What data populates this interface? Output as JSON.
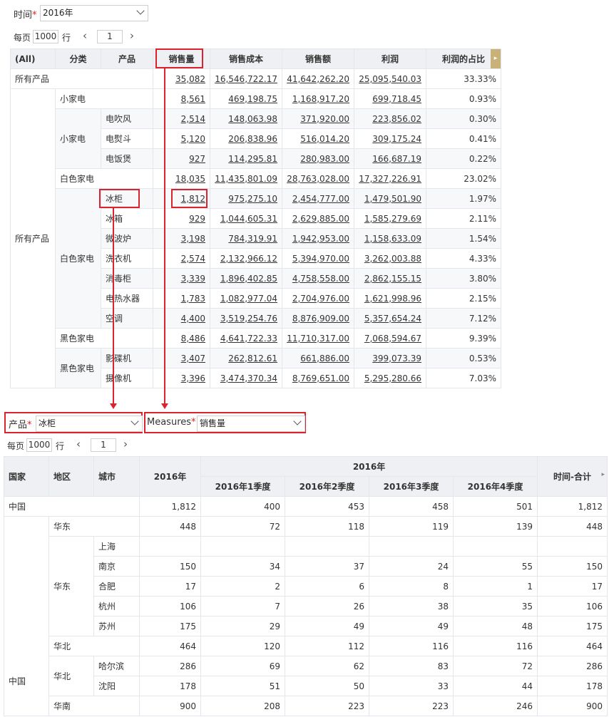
{
  "top": {
    "time_label": "时间",
    "time_value": "2016年",
    "pager": {
      "per_page": "每页",
      "rows": "1000",
      "unit": "行",
      "page": "1"
    },
    "headers": [
      "(All)",
      "分类",
      "产品",
      "销售量",
      "销售成本",
      "销售额",
      "利润",
      "利润的占比"
    ],
    "total_row": {
      "label": "所有产品",
      "vals": [
        "35,082",
        "16,546,722.17",
        "41,642,262.20",
        "25,095,540.03",
        "33.33%"
      ]
    },
    "group_label": "所有产品",
    "rows": [
      {
        "cat": "小家电",
        "prod": "",
        "vals": [
          "8,561",
          "469,198.75",
          "1,168,917.20",
          "699,718.45",
          "0.93%"
        ]
      },
      {
        "cat": "",
        "prod": "电吹风",
        "vals": [
          "2,514",
          "148,063.98",
          "371,920.00",
          "223,856.02",
          "0.30%"
        ]
      },
      {
        "cat": "小家电",
        "prod": "电熨斗",
        "vals": [
          "5,120",
          "206,838.96",
          "516,014.20",
          "309,175.24",
          "0.41%"
        ]
      },
      {
        "cat": "",
        "prod": "电饭煲",
        "vals": [
          "927",
          "114,295.81",
          "280,983.00",
          "166,687.19",
          "0.22%"
        ]
      },
      {
        "cat": "白色家电",
        "prod": "",
        "vals": [
          "18,035",
          "11,435,801.09",
          "28,763,028.00",
          "17,327,226.91",
          "23.02%"
        ]
      },
      {
        "cat": "",
        "prod": "冰柜",
        "vals": [
          "1,812",
          "975,275.10",
          "2,454,777.00",
          "1,479,501.90",
          "1.97%"
        ]
      },
      {
        "cat": "",
        "prod": "冰箱",
        "vals": [
          "929",
          "1,044,605.31",
          "2,629,885.00",
          "1,585,279.69",
          "2.11%"
        ]
      },
      {
        "cat": "",
        "prod": "微波炉",
        "vals": [
          "3,198",
          "784,319.91",
          "1,942,953.00",
          "1,158,633.09",
          "1.54%"
        ]
      },
      {
        "cat": "白色家电",
        "prod": "洗衣机",
        "vals": [
          "2,574",
          "2,132,966.12",
          "5,394,970.00",
          "3,262,003.88",
          "4.33%"
        ]
      },
      {
        "cat": "",
        "prod": "消毒柜",
        "vals": [
          "3,339",
          "1,896,402.85",
          "4,758,558.00",
          "2,862,155.15",
          "3.80%"
        ]
      },
      {
        "cat": "",
        "prod": "电热水器",
        "vals": [
          "1,783",
          "1,082,977.04",
          "2,704,976.00",
          "1,621,998.96",
          "2.15%"
        ]
      },
      {
        "cat": "",
        "prod": "空调",
        "vals": [
          "4,400",
          "3,519,254.76",
          "8,876,909.00",
          "5,357,654.24",
          "7.12%"
        ]
      },
      {
        "cat": "黑色家电",
        "prod": "",
        "vals": [
          "8,486",
          "4,641,722.33",
          "11,710,317.00",
          "7,068,594.67",
          "9.39%"
        ]
      },
      {
        "cat": "",
        "prod": "影碟机",
        "vals": [
          "3,407",
          "262,812.61",
          "661,886.00",
          "399,073.39",
          "0.53%"
        ]
      },
      {
        "cat": "黑色家电",
        "prod": "摄像机",
        "vals": [
          "3,396",
          "3,474,370.34",
          "8,769,651.00",
          "5,295,280.66",
          "7.03%"
        ]
      }
    ]
  },
  "filters": {
    "product_label": "产品",
    "product_value": "冰柜",
    "measures_label": "Measures",
    "measures_value": "销售量"
  },
  "bottom": {
    "pager": {
      "per_page": "每页",
      "rows": "1000",
      "unit": "行",
      "page": "1"
    },
    "headers": {
      "country": "国家",
      "region": "地区",
      "city": "城市",
      "year": "2016年",
      "year_group": "2016年",
      "q1": "2016年1季度",
      "q2": "2016年2季度",
      "q3": "2016年3季度",
      "q4": "2016年4季度",
      "total": "时间-合计"
    },
    "total_row": {
      "label": "中国",
      "vals": [
        "1,812",
        "400",
        "453",
        "458",
        "501",
        "1,812"
      ]
    },
    "country_label": "中国",
    "rows": [
      {
        "region": "华东",
        "city": "",
        "vals": [
          "448",
          "72",
          "118",
          "119",
          "139",
          "448"
        ]
      },
      {
        "region": "",
        "city": "上海",
        "vals": [
          "",
          "",
          "",
          "",
          "",
          ""
        ]
      },
      {
        "region": "",
        "city": "南京",
        "vals": [
          "150",
          "34",
          "37",
          "24",
          "55",
          "150"
        ]
      },
      {
        "region": "华东",
        "city": "合肥",
        "vals": [
          "17",
          "2",
          "6",
          "8",
          "1",
          "17"
        ]
      },
      {
        "region": "",
        "city": "杭州",
        "vals": [
          "106",
          "7",
          "26",
          "38",
          "35",
          "106"
        ]
      },
      {
        "region": "",
        "city": "苏州",
        "vals": [
          "175",
          "29",
          "49",
          "49",
          "48",
          "175"
        ]
      },
      {
        "region": "华北",
        "city": "",
        "vals": [
          "464",
          "120",
          "112",
          "116",
          "116",
          "464"
        ]
      },
      {
        "region": "华北",
        "city": "哈尔滨",
        "vals": [
          "286",
          "69",
          "62",
          "83",
          "72",
          "286"
        ]
      },
      {
        "region": "",
        "city": "沈阳",
        "vals": [
          "178",
          "51",
          "50",
          "33",
          "44",
          "178"
        ]
      },
      {
        "region": "华南",
        "city": "",
        "vals": [
          "900",
          "208",
          "223",
          "223",
          "246",
          "900"
        ]
      }
    ]
  }
}
